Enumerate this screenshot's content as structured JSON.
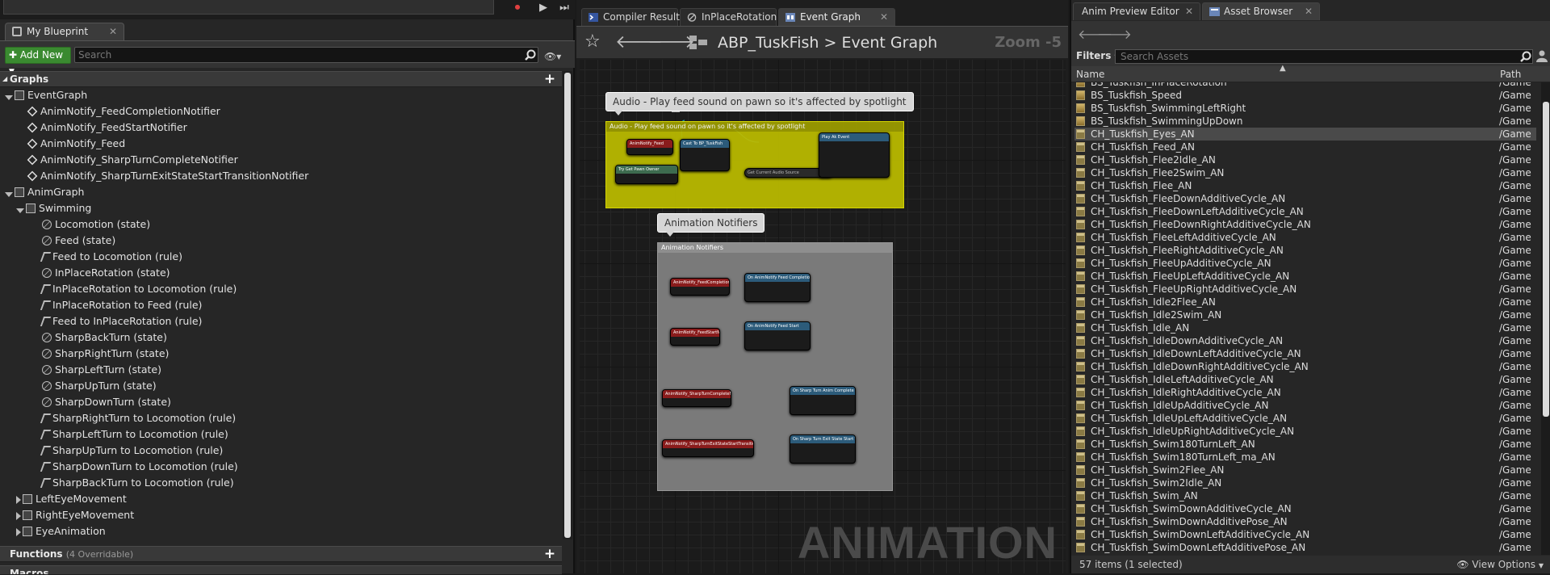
{
  "left": {
    "tab_label": "My Blueprint",
    "add_new_label": "Add New",
    "search_placeholder": "Search",
    "graphs_header": "Graphs",
    "functions_header": "Functions",
    "functions_sub": "(4 Overridable)",
    "macros_header": "Macros",
    "tree": [
      {
        "label": "EventGraph",
        "icon": "graph",
        "indent": 0,
        "expand": "down"
      },
      {
        "label": "AnimNotify_FeedCompletionNotifier",
        "icon": "diamond",
        "indent": 1
      },
      {
        "label": "AnimNotify_FeedStartNotifier",
        "icon": "diamond",
        "indent": 1
      },
      {
        "label": "AnimNotify_Feed",
        "icon": "diamond",
        "indent": 1
      },
      {
        "label": "AnimNotify_SharpTurnCompleteNotifier",
        "icon": "diamond",
        "indent": 1
      },
      {
        "label": "AnimNotify_SharpTurnExitStateStartTransitionNotifier",
        "icon": "diamond",
        "indent": 1
      },
      {
        "label": "AnimGraph",
        "icon": "graph",
        "indent": 0,
        "expand": "down"
      },
      {
        "label": "Swimming",
        "icon": "graph",
        "indent": 1,
        "expand": "down"
      },
      {
        "label": "Locomotion (state)",
        "icon": "state",
        "indent": 2
      },
      {
        "label": "Feed (state)",
        "icon": "state",
        "indent": 2
      },
      {
        "label": "Feed to Locomotion (rule)",
        "icon": "rule",
        "indent": 2
      },
      {
        "label": "InPlaceRotation (state)",
        "icon": "state",
        "indent": 2
      },
      {
        "label": "InPlaceRotation to Locomotion (rule)",
        "icon": "rule",
        "indent": 2
      },
      {
        "label": "InPlaceRotation to Feed (rule)",
        "icon": "rule",
        "indent": 2
      },
      {
        "label": "Feed to InPlaceRotation (rule)",
        "icon": "rule",
        "indent": 2
      },
      {
        "label": "SharpBackTurn (state)",
        "icon": "state",
        "indent": 2
      },
      {
        "label": "SharpRightTurn (state)",
        "icon": "state",
        "indent": 2
      },
      {
        "label": "SharpLeftTurn (state)",
        "icon": "state",
        "indent": 2
      },
      {
        "label": "SharpUpTurn (state)",
        "icon": "state",
        "indent": 2
      },
      {
        "label": "SharpDownTurn (state)",
        "icon": "state",
        "indent": 2
      },
      {
        "label": "SharpRightTurn to Locomotion (rule)",
        "icon": "rule",
        "indent": 2
      },
      {
        "label": "SharpLeftTurn to Locomotion (rule)",
        "icon": "rule",
        "indent": 2
      },
      {
        "label": "SharpUpTurn to Locomotion (rule)",
        "icon": "rule",
        "indent": 2
      },
      {
        "label": "SharpDownTurn to Locomotion (rule)",
        "icon": "rule",
        "indent": 2
      },
      {
        "label": "SharpBackTurn to Locomotion (rule)",
        "icon": "rule",
        "indent": 2
      },
      {
        "label": "LeftEyeMovement",
        "icon": "graph",
        "indent": 1,
        "expand": "right"
      },
      {
        "label": "RightEyeMovement",
        "icon": "graph",
        "indent": 1,
        "expand": "right"
      },
      {
        "label": "EyeAnimation",
        "icon": "graph",
        "indent": 1,
        "expand": "right"
      }
    ]
  },
  "center": {
    "tabs": [
      "Compiler Results",
      "InPlaceRotation (s",
      "Event Graph"
    ],
    "breadcrumb_root": "ABP_TuskFish",
    "breadcrumb_sep": ">",
    "breadcrumb_leaf": "Event Graph",
    "zoom": "Zoom -5",
    "comment1_bubble": "Audio - Play feed sound on pawn so it's affected by spotlight",
    "comment1_title": "Audio - Play feed sound on pawn so it's affected by spotlight",
    "comment2_bubble": "Animation Notifiers",
    "comment2_title": "Animation Notifiers",
    "watermark": "ANIMATION",
    "nodes": {
      "n1": "AnimNotify_Feed",
      "n2": "Cast To BP_TuskFish",
      "n3": "Try Get Pawn Owner",
      "n4": "Play Ak Event",
      "n5": "Get Current Audio Source",
      "n6": "AnimNotify_FeedCompletionNotifier",
      "n7": "On AnimNotify Feed Completion",
      "n8": "AnimNotify_FeedStartNotifier",
      "n9": "On AnimNotify Feed Start",
      "n10": "AnimNotify_SharpTurnCompleteNotifier",
      "n11": "On Sharp Turn Anim Complete",
      "n12": "AnimNotify_SharpTurnExitStateStartTransitionNotifier",
      "n13": "On Sharp Turn Exit State Start Transition"
    }
  },
  "right": {
    "tab_preview": "Anim Preview Editor",
    "tab_assets": "Asset Browser",
    "filters_label": "Filters",
    "search_placeholder": "Search Assets",
    "col_name": "Name",
    "col_path": "Path",
    "footer_count": "57 items (1 selected)",
    "footer_view": "View Options",
    "assets": [
      {
        "name": "BS_Tuskfish_InPlaceRotation",
        "path": "/Game",
        "type": "bs"
      },
      {
        "name": "BS_Tuskfish_Speed",
        "path": "/Game",
        "type": "bs"
      },
      {
        "name": "BS_Tuskfish_SwimmingLeftRight",
        "path": "/Game",
        "type": "bs"
      },
      {
        "name": "BS_Tuskfish_SwimmingUpDown",
        "path": "/Game",
        "type": "bs"
      },
      {
        "name": "CH_Tuskfish_Eyes_AN",
        "path": "/Game",
        "type": "an",
        "selected": true
      },
      {
        "name": "CH_Tuskfish_Feed_AN",
        "path": "/Game",
        "type": "an"
      },
      {
        "name": "CH_Tuskfish_Flee2Idle_AN",
        "path": "/Game",
        "type": "an"
      },
      {
        "name": "CH_Tuskfish_Flee2Swim_AN",
        "path": "/Game",
        "type": "an"
      },
      {
        "name": "CH_Tuskfish_Flee_AN",
        "path": "/Game",
        "type": "an"
      },
      {
        "name": "CH_Tuskfish_FleeDownAdditiveCycle_AN",
        "path": "/Game",
        "type": "an"
      },
      {
        "name": "CH_Tuskfish_FleeDownLeftAdditiveCycle_AN",
        "path": "/Game",
        "type": "an"
      },
      {
        "name": "CH_Tuskfish_FleeDownRightAdditiveCycle_AN",
        "path": "/Game",
        "type": "an"
      },
      {
        "name": "CH_Tuskfish_FleeLeftAdditiveCycle_AN",
        "path": "/Game",
        "type": "an"
      },
      {
        "name": "CH_Tuskfish_FleeRightAdditiveCycle_AN",
        "path": "/Game",
        "type": "an"
      },
      {
        "name": "CH_Tuskfish_FleeUpAdditiveCycle_AN",
        "path": "/Game",
        "type": "an"
      },
      {
        "name": "CH_Tuskfish_FleeUpLeftAdditiveCycle_AN",
        "path": "/Game",
        "type": "an"
      },
      {
        "name": "CH_Tuskfish_FleeUpRightAdditiveCycle_AN",
        "path": "/Game",
        "type": "an"
      },
      {
        "name": "CH_Tuskfish_Idle2Flee_AN",
        "path": "/Game",
        "type": "an"
      },
      {
        "name": "CH_Tuskfish_Idle2Swim_AN",
        "path": "/Game",
        "type": "an"
      },
      {
        "name": "CH_Tuskfish_Idle_AN",
        "path": "/Game",
        "type": "an"
      },
      {
        "name": "CH_Tuskfish_IdleDownAdditiveCycle_AN",
        "path": "/Game",
        "type": "an"
      },
      {
        "name": "CH_Tuskfish_IdleDownLeftAdditiveCycle_AN",
        "path": "/Game",
        "type": "an"
      },
      {
        "name": "CH_Tuskfish_IdleDownRightAdditiveCycle_AN",
        "path": "/Game",
        "type": "an"
      },
      {
        "name": "CH_Tuskfish_IdleLeftAdditiveCycle_AN",
        "path": "/Game",
        "type": "an"
      },
      {
        "name": "CH_Tuskfish_IdleRightAdditiveCycle_AN",
        "path": "/Game",
        "type": "an"
      },
      {
        "name": "CH_Tuskfish_IdleUpAdditiveCycle_AN",
        "path": "/Game",
        "type": "an"
      },
      {
        "name": "CH_Tuskfish_IdleUpLeftAdditiveCycle_AN",
        "path": "/Game",
        "type": "an"
      },
      {
        "name": "CH_Tuskfish_IdleUpRightAdditiveCycle_AN",
        "path": "/Game",
        "type": "an"
      },
      {
        "name": "CH_Tuskfish_Swim180TurnLeft_AN",
        "path": "/Game",
        "type": "an"
      },
      {
        "name": "CH_Tuskfish_Swim180TurnLeft_ma_AN",
        "path": "/Game",
        "type": "an"
      },
      {
        "name": "CH_Tuskfish_Swim2Flee_AN",
        "path": "/Game",
        "type": "an"
      },
      {
        "name": "CH_Tuskfish_Swim2Idle_AN",
        "path": "/Game",
        "type": "an"
      },
      {
        "name": "CH_Tuskfish_Swim_AN",
        "path": "/Game",
        "type": "an"
      },
      {
        "name": "CH_Tuskfish_SwimDownAdditiveCycle_AN",
        "path": "/Game",
        "type": "an"
      },
      {
        "name": "CH_Tuskfish_SwimDownAdditivePose_AN",
        "path": "/Game",
        "type": "an"
      },
      {
        "name": "CH_Tuskfish_SwimDownLeftAdditiveCycle_AN",
        "path": "/Game",
        "type": "an"
      },
      {
        "name": "CH_Tuskfish_SwimDownLeftAdditivePose_AN",
        "path": "/Game",
        "type": "an"
      }
    ]
  },
  "colors": {
    "add_new": "#3a8a30",
    "comment_audio": "#b8b800",
    "comment_notifiers": "#7a7a7a",
    "event_node_header": "#8a1c1c",
    "function_node_header": "#2c5b7a",
    "pawn_node_header": "#3d6b4f"
  }
}
